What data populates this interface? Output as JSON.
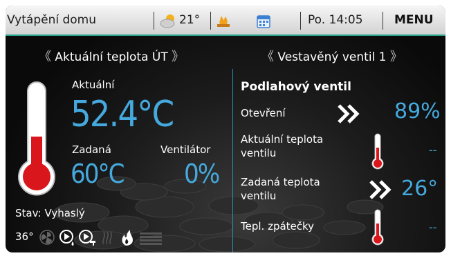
{
  "header": {
    "title": "Vytápění domu",
    "weather_temp": "21°",
    "datetime": "Po. 14:05",
    "menu_label": "MENU"
  },
  "left_panel": {
    "nav_label": "Aktuální teplota ÚT",
    "current_label": "Aktuální",
    "current_value": "52.4°C",
    "set_label": "Zadaná",
    "set_value": "60°C",
    "fan_label": "Ventilátor",
    "fan_value": "0%",
    "thermometer_level": 0.45,
    "state": "Stav: Vyhaslý",
    "bottom_temp": "36°"
  },
  "right_panel": {
    "nav_label": "Vestavěný ventil 1",
    "title": "Podlahový ventil",
    "opening_label": "Otevření",
    "opening_value": "89%",
    "valve_temp_label_1": "Aktuální teplota",
    "valve_temp_label_2": "ventilu",
    "valve_temp_value": "--",
    "set_valve_temp_label_1": "Zadaná teplota",
    "set_valve_temp_label_2": "ventilu",
    "set_valve_temp_value": "26°",
    "return_temp_label": "Tepl. zpátečky",
    "return_temp_value": "--"
  },
  "colors": {
    "accent": "#45a9dd",
    "thermometer_red": "#d9161b",
    "header_border": "#2aa38a"
  }
}
